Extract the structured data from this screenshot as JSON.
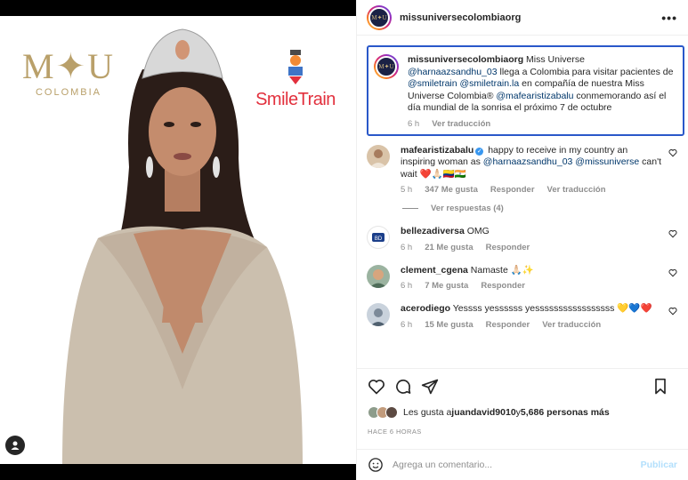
{
  "post_image": {
    "logo_left_mark": "M✦U",
    "logo_left_country": "COLOMBIA",
    "logo_right_text": "SmileTrain"
  },
  "header": {
    "username": "missuniversecolombiaorg",
    "more_label": "•••",
    "avatar_text": "M✦U"
  },
  "caption": {
    "username": "missuniversecolombiaorg",
    "text_1": " Miss Universe ",
    "mention_1": "@harnaazsandhu_03",
    "text_2": " llega a Colombia para visitar pacientes de ",
    "mention_2": "@smiletrain",
    "text_3": " ",
    "mention_3": "@smiletrain.la",
    "text_4": " en compañía de nuestra Miss Universe Colombia® ",
    "mention_4": "@mafearistizabalu",
    "text_5": " conmemorando así el día mundial de la sonrisa el próximo 7 de octubre",
    "time": "6 h",
    "translate": "Ver traducción"
  },
  "comments": [
    {
      "username": "mafearistizabalu",
      "text_1": " happy to receive in my country an inspiring woman as ",
      "mention_1": "@harnaazsandhu_03",
      "text_2": " ",
      "mention_2": "@missuniverse",
      "text_3": " can't wait ❤️🙏🏻🇨🇴🇮🇳",
      "time": "5 h",
      "likes": "347 Me gusta",
      "reply": "Responder",
      "translate": "Ver traducción",
      "view_replies": "Ver respuestas (4)"
    },
    {
      "username": "bellezadiversa",
      "text": " OMG",
      "time": "6 h",
      "likes": "21 Me gusta",
      "reply": "Responder"
    },
    {
      "username": "clement_cgena",
      "text": " Namaste 🙏🏻✨",
      "time": "6 h",
      "likes": "7 Me gusta",
      "reply": "Responder"
    },
    {
      "username": "acerodiego",
      "text": " Yessss yessssss yesssssssssssssssss 💛💙❤️",
      "time": "6 h",
      "likes": "15 Me gusta",
      "reply": "Responder",
      "translate": "Ver traducción"
    }
  ],
  "likes_summary": {
    "prefix": "Les gusta a ",
    "user": "juandavid9010",
    "middle": " y ",
    "others": "5,686 personas más"
  },
  "timestamp": "HACE 6 HORAS",
  "comment_box": {
    "placeholder": "Agrega un comentario...",
    "publish": "Publicar"
  },
  "colors": {
    "accent": "#2a58c9",
    "link": "#00376b",
    "publish": "#b2dffc",
    "smile_red": "#e2303d",
    "gold": "#b9a06a"
  }
}
